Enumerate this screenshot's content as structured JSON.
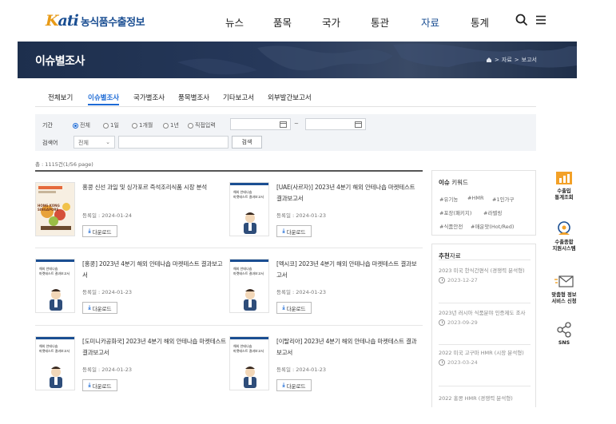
{
  "header": {
    "logo_mark_a": "K",
    "logo_mark_b": "ati",
    "logo_text": "농식품수출정보",
    "nav": [
      {
        "label": "뉴스"
      },
      {
        "label": "품목"
      },
      {
        "label": "국가"
      },
      {
        "label": "통관"
      },
      {
        "label": "자료",
        "active": true
      },
      {
        "label": "통계"
      }
    ],
    "icons": [
      "search-icon",
      "menu-icon"
    ]
  },
  "banner": {
    "title": "이슈별조사",
    "breadcrumb": [
      "자료",
      "보고서"
    ],
    "home_icon": "home-icon"
  },
  "tabs": [
    {
      "label": "전체보기"
    },
    {
      "label": "이슈별조사",
      "active": true
    },
    {
      "label": "국가별조사"
    },
    {
      "label": "품목별조사"
    },
    {
      "label": "기타보고서"
    },
    {
      "label": "외부발간보고서"
    }
  ],
  "filter": {
    "period_label": "기간",
    "period_options": [
      {
        "label": "전체",
        "selected": true
      },
      {
        "label": "1일"
      },
      {
        "label": "1개월"
      },
      {
        "label": "1년"
      },
      {
        "label": "직접입력"
      }
    ],
    "date_from": "",
    "date_to": "",
    "tilde": "~",
    "search_label": "검색어",
    "search_scope": "전체",
    "search_value": "",
    "search_button": "검색"
  },
  "list": {
    "count_text": "총 : 1115건(1/56 page)",
    "download_label": "다운로드",
    "date_prefix": "등록일 : ",
    "items": [
      {
        "title": "홍콩 신선 과일 및 싱가포르 즉석조리식품 시장 분석",
        "date": "2024-01-24",
        "thumb": "fruit-cover"
      },
      {
        "title": "[UAE(사르자)] 2023년 4분기 해외 안테나숍 마켓테스트 결과보고서",
        "date": "2024-01-23",
        "thumb": "antenna-cover"
      },
      {
        "title": "[홍콩] 2023년 4분기 해외 안테나숍 마켓테스트 결과보고서",
        "date": "2024-01-23",
        "thumb": "antenna-cover"
      },
      {
        "title": "[멕시코] 2023년 4분기 해외 안테나숍 마켓테스트 결과보고서",
        "date": "2024-01-23",
        "thumb": "antenna-cover"
      },
      {
        "title": "[도미니카공화국] 2023년 4분기 해외 안테나숍 마켓테스트 결과보고서",
        "date": "2024-01-23",
        "thumb": "antenna-cover"
      },
      {
        "title": "[이탈리아] 2023년 4분기 해외 안테나숍 마켓테스트 결과보고서",
        "date": "2024-01-23",
        "thumb": "antenna-cover"
      }
    ],
    "thumb_text": {
      "fruit_title": "HONG KONG SINGAPORE",
      "antenna_line1": "해외 안테나숍",
      "antenna_line2": "마켓테스트 결과보고서"
    }
  },
  "keywords": {
    "title_bold": "이슈",
    "title_rest": " 키워드",
    "tags": [
      "#유기농",
      "#HMR",
      "#1인가구",
      "#포장(패키지)",
      "#라벨링",
      "#식품안전",
      "#매운맛(Hot/Red)"
    ]
  },
  "recommended": {
    "title_bold": "추천",
    "title_rest": "자료",
    "items": [
      {
        "title": "2023 미국 한식간편식 (경쟁력 분석형)",
        "date": "2023-12-27"
      },
      {
        "title": "2023년 러시아 식품분야 인증제도 조사",
        "date": "2023-09-29"
      },
      {
        "title": "2022 미국 고구마 HMR (시장 분석형)",
        "date": "2023-03-24"
      },
      {
        "title": "2022 홍콩 HMR (경쟁력 분석형)",
        "date": ""
      }
    ]
  },
  "quick_menu": [
    {
      "label1": "수출입",
      "label2": "통계조회",
      "icon": "chart-icon"
    },
    {
      "label1": "수출종합",
      "label2": "지원시스템",
      "icon": "support-icon"
    },
    {
      "label1": "맞춤형 정보",
      "label2": "서비스 신청",
      "icon": "mail-icon"
    },
    {
      "label1": "SNS",
      "label2": "",
      "icon": "share-icon"
    }
  ],
  "colors": {
    "brand": "#1a4e92",
    "accent_orange": "#e89b18",
    "tab_active": "#1e6bd6",
    "banner_bg": "#26385a"
  }
}
